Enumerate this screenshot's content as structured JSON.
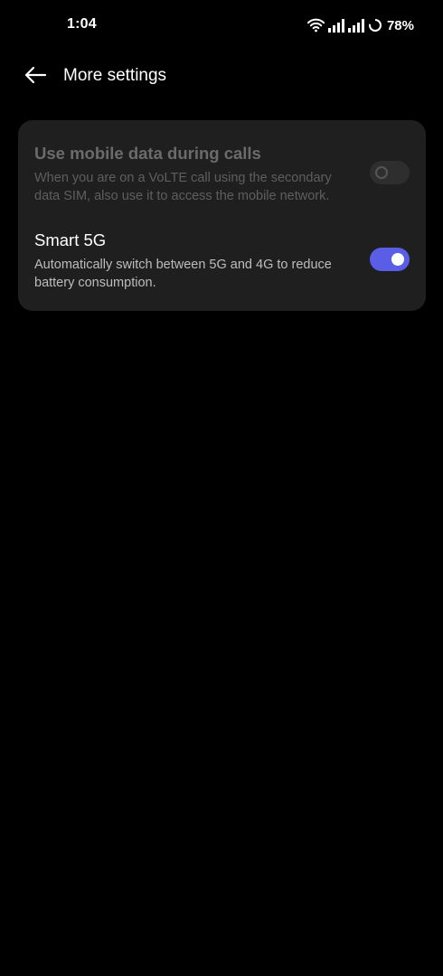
{
  "status_bar": {
    "time": "1:04",
    "battery": "78%",
    "icons": [
      "wifi-icon",
      "signal-icon",
      "signal-icon",
      "battery-icon"
    ]
  },
  "header": {
    "back_icon": "arrow-left-icon",
    "title": "More settings"
  },
  "settings": [
    {
      "title": "Use mobile data during calls",
      "description": "When you are on a VoLTE call using the secondary data SIM, also use it to access the mobile network.",
      "enabled": false,
      "disabled": true
    },
    {
      "title": "Smart 5G",
      "description": "Automatically switch between 5G and 4G to reduce battery consumption.",
      "enabled": true,
      "disabled": false
    }
  ],
  "colors": {
    "background": "#000000",
    "card": "#1f1f1f",
    "accent": "#5a5ee6"
  }
}
